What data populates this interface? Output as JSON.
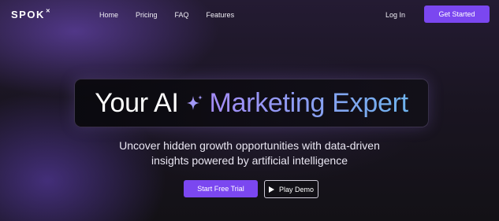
{
  "nav": {
    "logo": "SPOK",
    "logo_mark": "✕",
    "links": [
      "Home",
      "Pricing",
      "FAQ",
      "Features"
    ],
    "login_label": "Log In",
    "cta_label": "Get Started"
  },
  "hero": {
    "headline_part1": "Your AI",
    "headline_icon": "sparkle-icon",
    "headline_part2": "Marketing Expert",
    "subtitle_line1": "Uncover hidden growth opportunities with data-driven",
    "subtitle_line2": "insights powered by artificial intelligence",
    "primary_button": "Start Free Trial",
    "secondary_button": "Play Demo",
    "secondary_icon": "play-icon"
  },
  "colors": {
    "accent": "#7b47f0",
    "gradient_start": "#a58cf7",
    "gradient_end": "#6fb3ee",
    "background": "#131116"
  }
}
